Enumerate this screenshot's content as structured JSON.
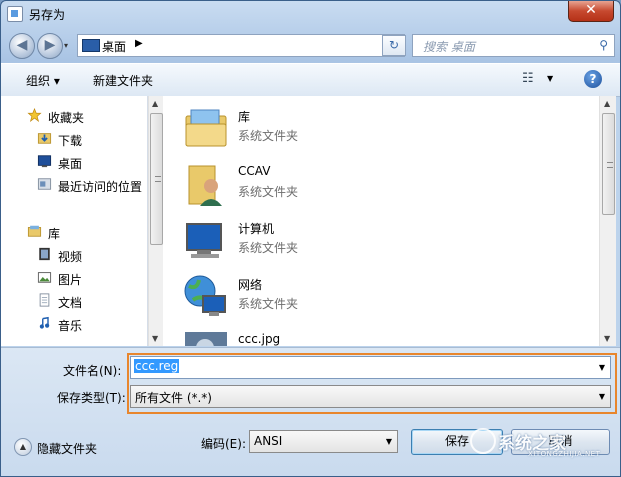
{
  "window": {
    "title": "另存为",
    "close_glyph": "✕"
  },
  "nav": {
    "back_glyph": "◀",
    "forward_glyph": "▶",
    "history_glyph": "▾"
  },
  "address": {
    "location": "桌面",
    "separator": "▶",
    "dropdown_glyph": "▼",
    "refresh_glyph": "↻"
  },
  "search": {
    "placeholder": "搜索 桌面",
    "icon_glyph": "⚲"
  },
  "toolbar": {
    "organize": "组织 ▾",
    "new_folder": "新建文件夹",
    "view_glyph": "☷",
    "view_drop": "▼",
    "help_glyph": "?"
  },
  "sidebar": {
    "favorites_label": "收藏夹",
    "favorites": [
      {
        "label": "下载"
      },
      {
        "label": "桌面"
      },
      {
        "label": "最近访问的位置"
      }
    ],
    "libraries_label": "库",
    "libraries": [
      {
        "label": "视频"
      },
      {
        "label": "图片"
      },
      {
        "label": "文档"
      },
      {
        "label": "音乐"
      }
    ]
  },
  "scroll": {
    "up": "▲",
    "down": "▼"
  },
  "files": [
    {
      "name": "库",
      "type": "系统文件夹"
    },
    {
      "name": "CCAV",
      "type": "系统文件夹"
    },
    {
      "name": "计算机",
      "type": "系统文件夹"
    },
    {
      "name": "网络",
      "type": "系统文件夹"
    },
    {
      "name": "ccc.jpg",
      "type": ""
    }
  ],
  "form": {
    "filename_label": "文件名(N):",
    "filename_value": "ccc.reg",
    "savetype_label": "保存类型(T):",
    "savetype_value": "所有文件  (*.*)",
    "dropdown_glyph": "▼",
    "encoding_label": "编码(E):",
    "encoding_value": "ANSI",
    "hide_folders": "隐藏文件夹",
    "hide_glyph": "▲",
    "save_button": "保存",
    "cancel_button": "取消"
  },
  "watermark": {
    "text": "系统之家",
    "sub": "XITONGZHIJIA.NET"
  },
  "colors": {
    "highlight_border": "#e8862d",
    "selection": "#3399ff",
    "title_bar": "#a9c4e4"
  }
}
